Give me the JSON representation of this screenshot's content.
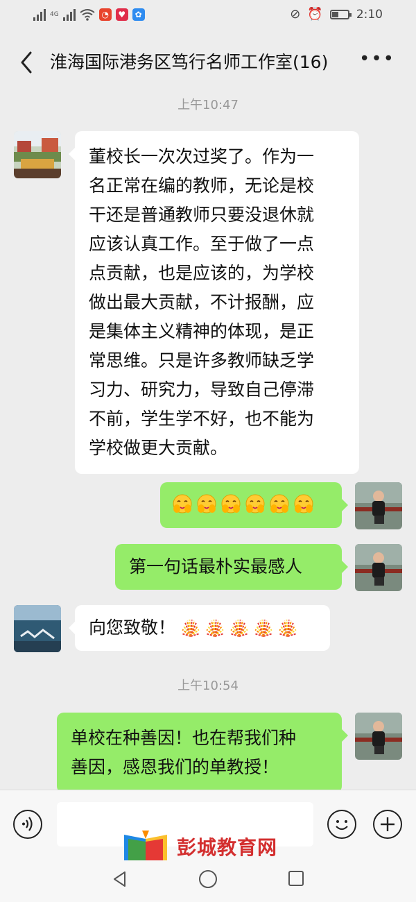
{
  "status_bar": {
    "network_type": "4G",
    "time": "2:10"
  },
  "header": {
    "title": "淮海国际港务区笃行名师工作室(16)",
    "back_icon": "back-icon",
    "more_icon": "more-icon"
  },
  "messages": {
    "ts1": "上午10:47",
    "m1": {
      "lines": [
        "董校长一次次过奖了。作为一",
        "名正常在编的教师，无论是校",
        "干还是普通教师只要没退休就",
        "应该认真工作。至于做了一点",
        "点贡献，也是应该的，为学校",
        "做出最大贡献，不计报酬，应",
        "是集体主义精神的体现，是正",
        "常思维。只是许多教师缺乏学",
        "习力、研究力，导致自己停滞",
        "不前，学生学不好，也不能为",
        "学校做更大贡献。"
      ]
    },
    "m2": {
      "emoji": "covered-face-emoji",
      "count": 6
    },
    "m3": {
      "text": "第一句话最朴实最感人"
    },
    "m4": {
      "text": "向您致敬！",
      "emoji": "fireworks-emoji",
      "count": 5
    },
    "ts2": "上午10:54",
    "m5": {
      "lines": [
        "单校在种善因！也在帮我们种",
        "善因，感恩我们的单教授！"
      ]
    }
  },
  "watermark": {
    "text": "彭城教育网"
  },
  "colors": {
    "background": "#ededed",
    "sent_bubble": "#95ec69",
    "received_bubble": "#ffffff",
    "watermark": "#d32f2f"
  }
}
